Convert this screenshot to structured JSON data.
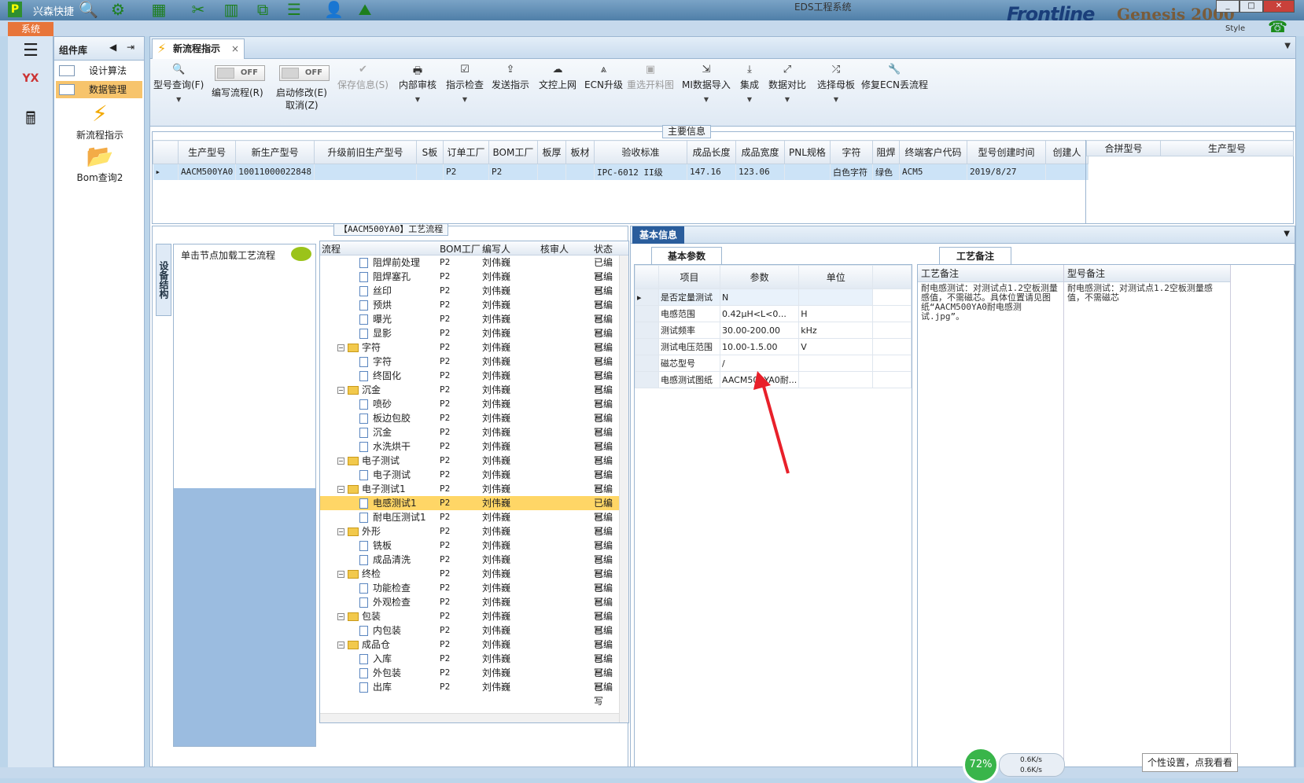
{
  "titlebar": {
    "app_name": "兴森快捷",
    "window_title": "EDS工程系统",
    "brand": "Frontline",
    "brand2": "Genesis 2000",
    "style_label": "Style"
  },
  "system_tab": "系统",
  "component_panel": {
    "title": "组件库",
    "items": [
      "设计算法",
      "数据管理"
    ],
    "buttons": [
      "新流程指示",
      "Bom查询2"
    ]
  },
  "main_tab": {
    "label": "新流程指示"
  },
  "toolbar": {
    "model_query": "型号查询(F)",
    "edit_flow": "编写流程(R)",
    "start_modify": "启动修改(E)",
    "cancel": "取消(Z)",
    "toggle_off": "OFF",
    "save_info": "保存信息(S)",
    "internal_review": "内部审核",
    "instruction_check": "指示检查",
    "send_instruction": "发送指示",
    "doc_upload": "文控上网",
    "ecn_upgrade": "ECN升级",
    "resend_drawing": "重选开料图",
    "mi_import": "MI数据导入",
    "integrate": "集成",
    "data_compare": "数据对比",
    "select_mother": "选择母板",
    "repair_ecn": "修复ECN丢流程"
  },
  "main_info": {
    "legend": "主要信息",
    "columns": [
      "生产型号",
      "新生产型号",
      "升级前旧生产型号",
      "S板",
      "订单工厂",
      "BOM工厂",
      "板厚",
      "板材",
      "验收标准",
      "成品长度",
      "成品宽度",
      "PNL规格",
      "字符",
      "阻焊",
      "终端客户代码",
      "型号创建时间",
      "创建人"
    ],
    "rows": [
      [
        "AACM500YA0",
        "10011000022848",
        "",
        "",
        "P2",
        "P2",
        "",
        "",
        "IPC-6012 II级",
        "147.16",
        "123.06",
        "",
        "白色字符",
        "绿色",
        "ACM5",
        "2019/8/27",
        ""
      ]
    ],
    "merge_columns": [
      "合拼型号",
      "生产型号"
    ]
  },
  "process_panel": {
    "title": "【AACM500YA0】工艺流程",
    "vertical_tab": "设备结构",
    "load_hint": "单击节点加载工艺流程",
    "columns": [
      "流程",
      "BOM工厂",
      "编写人",
      "核审人",
      "状态"
    ],
    "rows": [
      {
        "name": "阻焊前处理",
        "level": 2,
        "bom": "P2",
        "writer": "刘伟巍",
        "status": "已编写"
      },
      {
        "name": "阻焊塞孔",
        "level": 2,
        "bom": "P2",
        "writer": "刘伟巍",
        "status": "已编写"
      },
      {
        "name": "丝印",
        "level": 2,
        "bom": "P2",
        "writer": "刘伟巍",
        "status": "已编写"
      },
      {
        "name": "预烘",
        "level": 2,
        "bom": "P2",
        "writer": "刘伟巍",
        "status": "已编写"
      },
      {
        "name": "曝光",
        "level": 2,
        "bom": "P2",
        "writer": "刘伟巍",
        "status": "已编写"
      },
      {
        "name": "显影",
        "level": 2,
        "bom": "P2",
        "writer": "刘伟巍",
        "status": "已编写"
      },
      {
        "name": "字符",
        "level": 1,
        "bom": "P2",
        "writer": "刘伟巍",
        "status": "已编写"
      },
      {
        "name": "字符",
        "level": 2,
        "bom": "P2",
        "writer": "刘伟巍",
        "status": "已编写"
      },
      {
        "name": "终固化",
        "level": 2,
        "bom": "P2",
        "writer": "刘伟巍",
        "status": "已编写"
      },
      {
        "name": "沉金",
        "level": 1,
        "bom": "P2",
        "writer": "刘伟巍",
        "status": "已编写"
      },
      {
        "name": "喷砂",
        "level": 2,
        "bom": "P2",
        "writer": "刘伟巍",
        "status": "已编写"
      },
      {
        "name": "板边包胶",
        "level": 2,
        "bom": "P2",
        "writer": "刘伟巍",
        "status": "已编写"
      },
      {
        "name": "沉金",
        "level": 2,
        "bom": "P2",
        "writer": "刘伟巍",
        "status": "已编写"
      },
      {
        "name": "水洗烘干",
        "level": 2,
        "bom": "P2",
        "writer": "刘伟巍",
        "status": "已编写"
      },
      {
        "name": "电子测试",
        "level": 1,
        "bom": "P2",
        "writer": "刘伟巍",
        "status": "已编写"
      },
      {
        "name": "电子测试",
        "level": 2,
        "bom": "P2",
        "writer": "刘伟巍",
        "status": "已编写"
      },
      {
        "name": "电子测试1",
        "level": 1,
        "bom": "P2",
        "writer": "刘伟巍",
        "status": "已编写"
      },
      {
        "name": "电感测试1",
        "level": 2,
        "bom": "P2",
        "writer": "刘伟巍",
        "status": "已编写",
        "selected": true
      },
      {
        "name": "耐电压测试1",
        "level": 2,
        "bom": "P2",
        "writer": "刘伟巍",
        "status": "已编写"
      },
      {
        "name": "外形",
        "level": 1,
        "bom": "P2",
        "writer": "刘伟巍",
        "status": "已编写"
      },
      {
        "name": "铣板",
        "level": 2,
        "bom": "P2",
        "writer": "刘伟巍",
        "status": "已编写"
      },
      {
        "name": "成品清洗",
        "level": 2,
        "bom": "P2",
        "writer": "刘伟巍",
        "status": "已编写"
      },
      {
        "name": "终检",
        "level": 1,
        "bom": "P2",
        "writer": "刘伟巍",
        "status": "已编写"
      },
      {
        "name": "功能检查",
        "level": 2,
        "bom": "P2",
        "writer": "刘伟巍",
        "status": "已编写"
      },
      {
        "name": "外观检查",
        "level": 2,
        "bom": "P2",
        "writer": "刘伟巍",
        "status": "已编写"
      },
      {
        "name": "包装",
        "level": 1,
        "bom": "P2",
        "writer": "刘伟巍",
        "status": "已编写"
      },
      {
        "name": "内包装",
        "level": 2,
        "bom": "P2",
        "writer": "刘伟巍",
        "status": "已编写"
      },
      {
        "name": "成品仓",
        "level": 1,
        "bom": "P2",
        "writer": "刘伟巍",
        "status": "已编写"
      },
      {
        "name": "入库",
        "level": 2,
        "bom": "P2",
        "writer": "刘伟巍",
        "status": "已编写"
      },
      {
        "name": "外包装",
        "level": 2,
        "bom": "P2",
        "writer": "刘伟巍",
        "status": "已编写"
      },
      {
        "name": "出库",
        "level": 2,
        "bom": "P2",
        "writer": "刘伟巍",
        "status": "已编写"
      }
    ]
  },
  "basic_info": {
    "tab": "基本信息",
    "param_tab": "基本参数",
    "param_columns": [
      "项目",
      "参数",
      "单位"
    ],
    "params": [
      {
        "item": "是否定量测试",
        "value": "N",
        "unit": ""
      },
      {
        "item": "电感范围",
        "value": "0.42μH<L<0...",
        "unit": "H"
      },
      {
        "item": "测试频率",
        "value": "30.00-200.00",
        "unit": "kHz"
      },
      {
        "item": "测试电压范围",
        "value": "10.00-1.5.00",
        "unit": "V"
      },
      {
        "item": "磁芯型号",
        "value": "/",
        "unit": ""
      },
      {
        "item": "电感测试图纸",
        "value": "AACM500YA0耐...",
        "unit": ""
      }
    ],
    "note_tab": "工艺备注",
    "note_col1": "工艺备注",
    "note_col2": "型号备注",
    "note1": "耐电感测试：对测试点1.2空板测量感值，不需磁芯。具体位置请见图纸“AACM500YA0耐电感测试.jpg”。",
    "note2": "耐电感测试：对测试点1.2空板测量感值，不需磁芯"
  },
  "status": {
    "gauge": "72%",
    "up_speed": "0.6K/s",
    "down_speed": "0.6K/s",
    "tooltip": "个性设置，点我看看"
  },
  "colors": {
    "accent": "#2a5d9c",
    "selection": "#ffd666",
    "annotation_arrow": "#e8202a"
  }
}
